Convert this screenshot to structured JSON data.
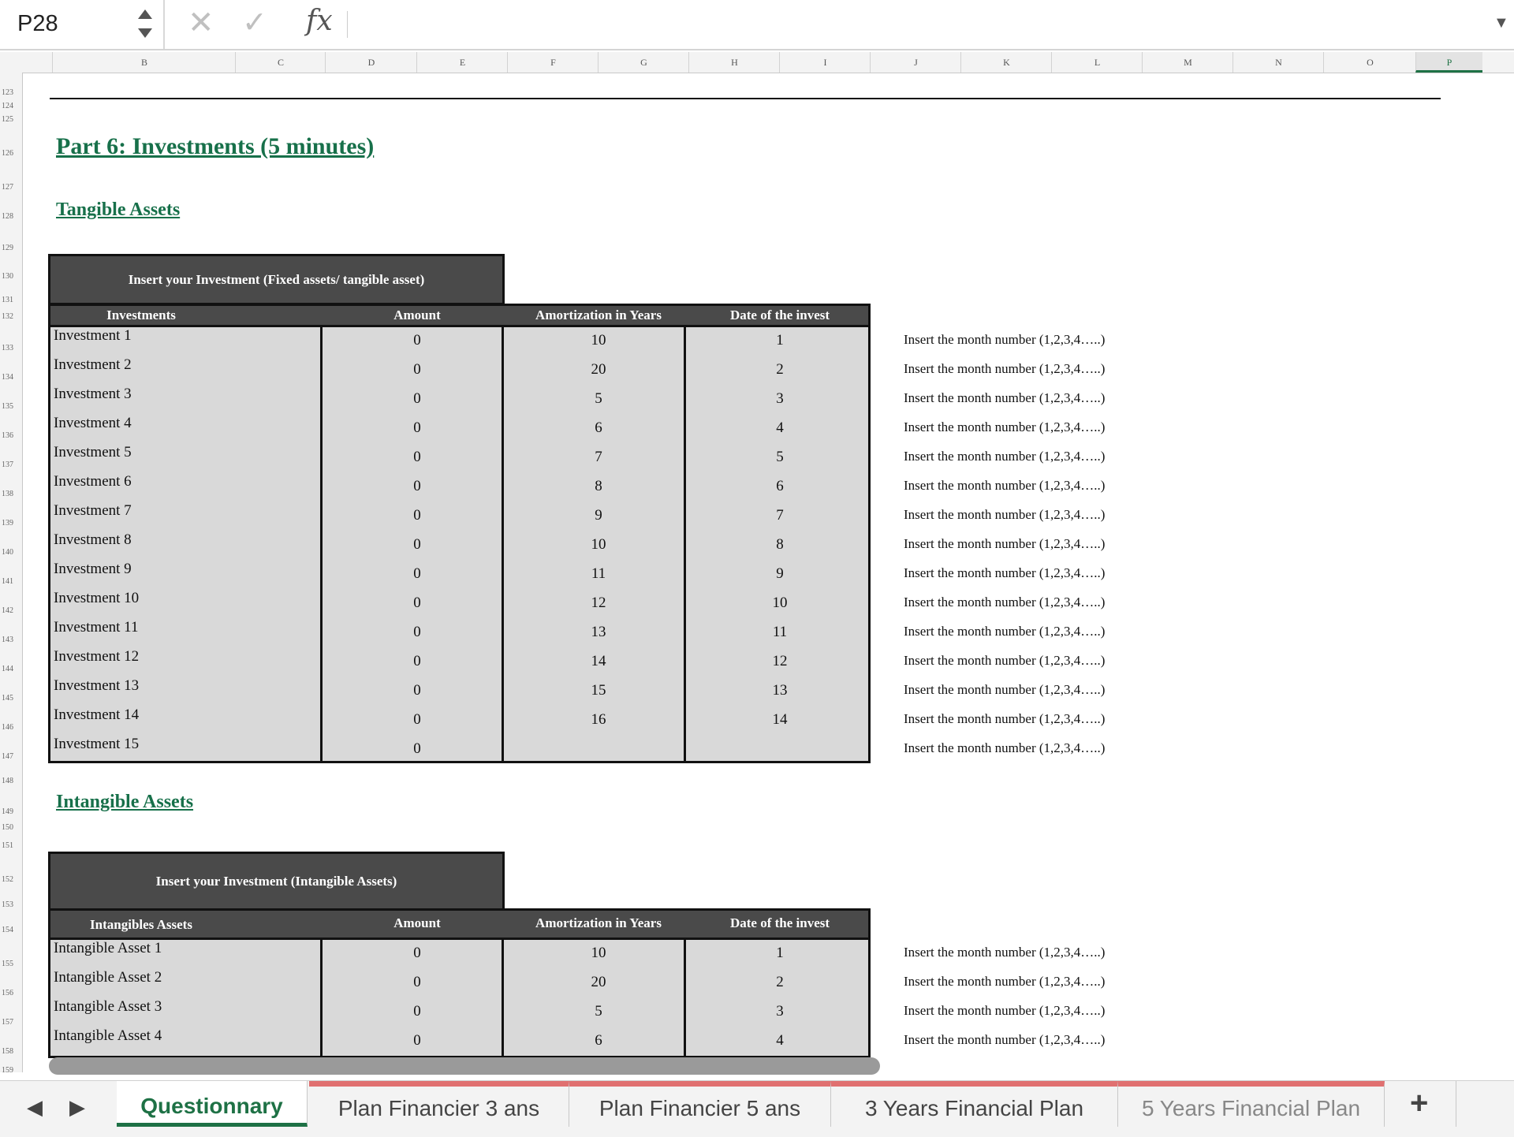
{
  "formula_bar": {
    "name_box": "P28",
    "cancel_icon": "close-icon",
    "enter_icon": "check-icon",
    "fx_label": "fx",
    "formula": ""
  },
  "columns": [
    "B",
    "C",
    "D",
    "E",
    "F",
    "G",
    "H",
    "I",
    "J",
    "K",
    "L",
    "M",
    "N",
    "O",
    "P"
  ],
  "selected_column": "P",
  "rows": [
    "123",
    "124",
    "125",
    "126",
    "127",
    "128",
    "129",
    "130",
    "131",
    "132",
    "133",
    "134",
    "135",
    "136",
    "137",
    "138",
    "139",
    "140",
    "141",
    "142",
    "143",
    "144",
    "145",
    "146",
    "147",
    "148",
    "149",
    "150",
    "151",
    "152",
    "153",
    "154",
    "155",
    "156",
    "157",
    "158",
    "159"
  ],
  "sheet": {
    "part_title": "Part 6: Investments (5 minutes)",
    "tangible_title": "Tangible Assets",
    "intangible_title": "Intangible  Assets",
    "tangible_table": {
      "caption": "Insert your Investment (Fixed assets/ tangible asset)",
      "headers": [
        "Investments",
        "Amount",
        "Amortization in Years",
        "Date of the invest"
      ],
      "rows": [
        [
          "Investment 1",
          "0",
          "10",
          "1"
        ],
        [
          "Investment 2",
          "0",
          "20",
          "2"
        ],
        [
          "Investment 3",
          "0",
          "5",
          "3"
        ],
        [
          "Investment 4",
          "0",
          "6",
          "4"
        ],
        [
          "Investment 5",
          "0",
          "7",
          "5"
        ],
        [
          "Investment 6",
          "0",
          "8",
          "6"
        ],
        [
          "Investment 7",
          "0",
          "9",
          "7"
        ],
        [
          "Investment 8",
          "0",
          "10",
          "8"
        ],
        [
          "Investment 9",
          "0",
          "11",
          "9"
        ],
        [
          "Investment 10",
          "0",
          "12",
          "10"
        ],
        [
          "Investment 11",
          "0",
          "13",
          "11"
        ],
        [
          "Investment 12",
          "0",
          "14",
          "12"
        ],
        [
          "Investment 13",
          "0",
          "15",
          "13"
        ],
        [
          "Investment 14",
          "0",
          "16",
          "14"
        ],
        [
          "Investment 15",
          "0",
          "",
          ""
        ]
      ]
    },
    "intangible_table": {
      "caption": "Insert your Investment (Intangible Assets)",
      "headers": [
        "Intangibles Assets",
        "Amount",
        "Amortization in Years",
        "Date of the invest"
      ],
      "rows": [
        [
          "Intangible Asset 1",
          "0",
          "10",
          "1"
        ],
        [
          "Intangible Asset 2",
          "0",
          "20",
          "2"
        ],
        [
          "Intangible Asset 3",
          "0",
          "5",
          "3"
        ],
        [
          "Intangible Asset 4",
          "0",
          "6",
          "4"
        ]
      ]
    },
    "note": "Insert the month number (1,2,3,4…..)"
  },
  "tabs": {
    "prev_icon": "chevron-left-icon",
    "next_icon": "chevron-right-icon",
    "items": [
      "Questionnary",
      "Plan Financier 3 ans",
      "Plan Financier 5 ans",
      "3 Years Financial Plan",
      "5 Years Financial Plan"
    ],
    "active": "Questionnary",
    "add_label": "+"
  }
}
